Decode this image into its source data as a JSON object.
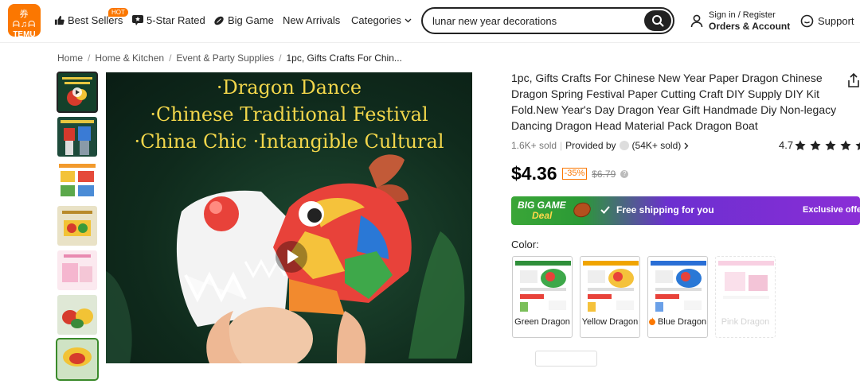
{
  "header": {
    "logo_glyphs": "券ᗩ♫ᗩ",
    "logo_word": "TEMU",
    "nav": {
      "best_sellers": "Best Sellers",
      "hot_badge": "HOT",
      "five_star": "5-Star Rated",
      "big_game": "Big Game",
      "new_arrivals": "New Arrivals",
      "categories": "Categories"
    },
    "search_value": "lunar new year decorations",
    "account_line1": "Sign in / Register",
    "account_line2": "Orders & Account",
    "support": "Support"
  },
  "breadcrumb": {
    "items": [
      "Home",
      "Home & Kitchen",
      "Event & Party Supplies",
      "1pc, Gifts Crafts For Chin..."
    ]
  },
  "hero": {
    "lines": [
      "·Dragon Dance",
      "·Chinese Traditional Festival",
      "·China Chic  ·Intangible Cultural"
    ]
  },
  "product": {
    "title": "1pc, Gifts Crafts For Chinese New Year Paper Dragon Chinese Dragon Spring Festival Paper Cutting Craft DIY Supply DIY Kit Fold.New Year's Day Dragon Year Gift Handmade Diy Non-legacy Dancing Dragon Head Material Pack Dragon Boat",
    "sold": "1.6K+ sold",
    "provided_by": "Provided by",
    "provider_sold": "(54K+ sold)",
    "rating_value": "4.7",
    "stars": 4.7,
    "price": "$4.36",
    "discount": "-35%",
    "original_price": "$6.79"
  },
  "banner": {
    "line1": "BIG GAME",
    "line2": "Deal",
    "shipping": "Free shipping for you",
    "exclusive": "Exclusive offer"
  },
  "color": {
    "label": "Color:",
    "options": [
      {
        "name": "Green Dragon",
        "accent": "#2f8f3a",
        "available": true
      },
      {
        "name": "Yellow Dragon",
        "accent": "#f0a400",
        "available": true
      },
      {
        "name": "Blue Dragon",
        "accent": "#2a6fd6",
        "available": true,
        "icon": "fire-icon"
      },
      {
        "name": "Pink Dragon",
        "accent": "#f2a2c6",
        "available": false
      }
    ]
  },
  "colors": {
    "brand": "#fb7701",
    "hero_text": "#f2d64b"
  }
}
